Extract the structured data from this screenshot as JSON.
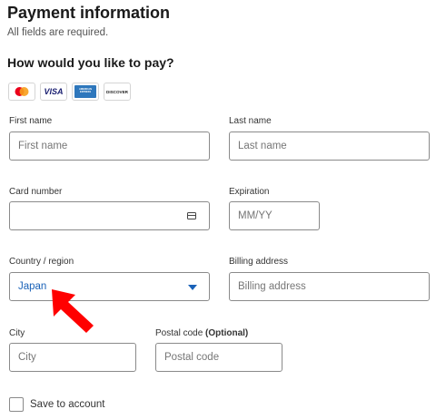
{
  "header": {
    "title": "Payment information",
    "subtitle": "All fields are required.",
    "question": "How would you like to pay?"
  },
  "card_brands": {
    "mastercard": "mastercard-icon",
    "visa": "VISA",
    "amex": "AMERICAN EXPRESS",
    "discover": "DISCOVER"
  },
  "form": {
    "first_name": {
      "label": "First name",
      "placeholder": "First name"
    },
    "last_name": {
      "label": "Last name",
      "placeholder": "Last name"
    },
    "card_number": {
      "label": "Card number",
      "placeholder": "",
      "icon": "credit-card-icon"
    },
    "expiration": {
      "label": "Expiration",
      "placeholder": "MM/YY"
    },
    "country": {
      "label": "Country / region",
      "value": "Japan"
    },
    "billing_address": {
      "label": "Billing address",
      "placeholder": "Billing address"
    },
    "city": {
      "label": "City",
      "placeholder": "City"
    },
    "postal_code": {
      "label": "Postal code",
      "label_optional": "(Optional)",
      "placeholder": "Postal code"
    },
    "save_to_account": {
      "label": "Save to account",
      "checked": false
    }
  },
  "colors": {
    "accent": "#1a62b8",
    "arrow": "#ff0000",
    "mastercard_red": "#eb001b",
    "mastercard_orange": "#f79e1b",
    "visa_blue": "#1a1f71",
    "amex_blue": "#2e77bc"
  }
}
